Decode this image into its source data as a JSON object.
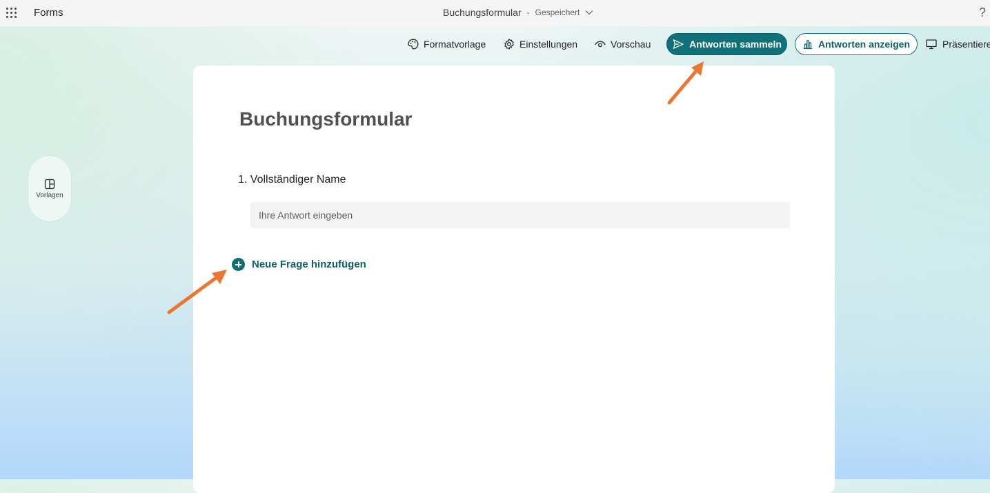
{
  "app": {
    "name": "Forms"
  },
  "document": {
    "title": "Buchungsformular",
    "separator": "-",
    "status": "Gespeichert"
  },
  "toolbar": {
    "format_label": "Formatvorlage",
    "settings_label": "Einstellungen",
    "preview_label": "Vorschau",
    "collect_label": "Antworten sammeln",
    "view_responses_label": "Antworten anzeigen",
    "present_label": "Präsentiere"
  },
  "sidebar": {
    "templates_label": "Vorlagen"
  },
  "form": {
    "title": "Buchungsformular",
    "questions": [
      {
        "label": "1. Vollständiger Name",
        "placeholder": "Ihre Antwort eingeben"
      }
    ],
    "add_question_label": "Neue Frage hinzufügen"
  },
  "colors": {
    "accent": "#107178",
    "arrow": "#ec7532"
  },
  "help": {
    "label": "?"
  }
}
